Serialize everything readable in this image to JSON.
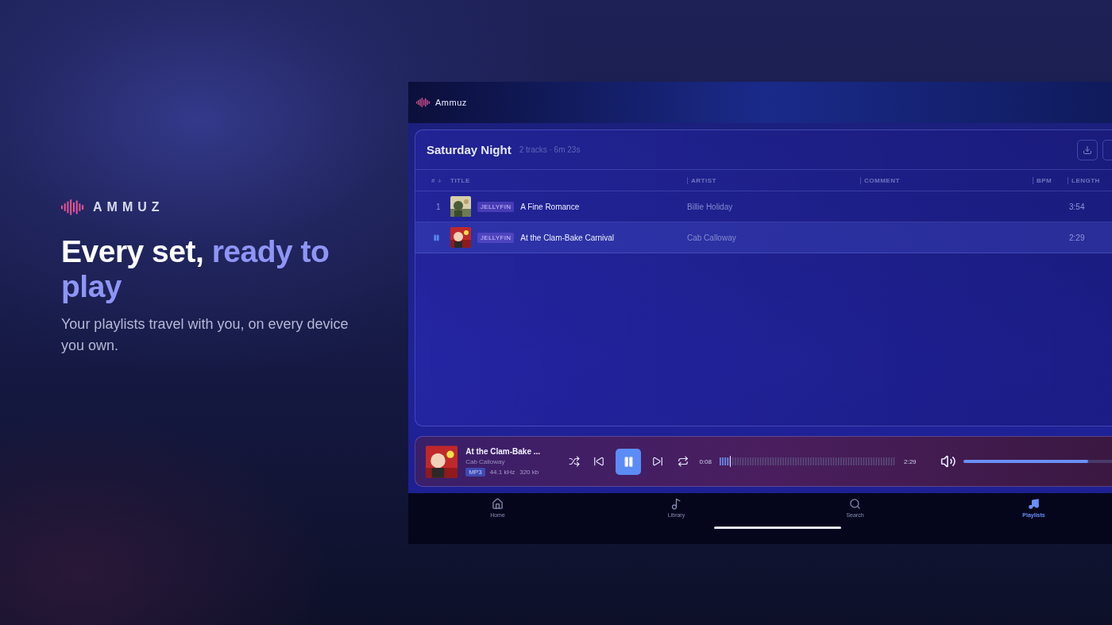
{
  "promo": {
    "brand": "AMMUZ",
    "headline": "Every set,",
    "headline_accent": "ready to play",
    "subtitle": "Your playlists travel with you, on every device you own."
  },
  "app": {
    "name": "Ammuz",
    "playlist": {
      "title": "Saturday Night",
      "meta": "2 tracks · 6m 23s"
    },
    "columns": [
      "#",
      "TITLE",
      "ARTIST",
      "COMMENT",
      "BPM",
      "LENGTH"
    ],
    "rows": [
      {
        "number": "1",
        "playing": false,
        "selected": false,
        "source": "JELLYFIN",
        "title": "A Fine Romance",
        "artist": "Billie Holiday",
        "length": "3:54"
      },
      {
        "playing": true,
        "selected": true,
        "source": "JELLYFIN",
        "title": "At the Clam-Bake Carnival",
        "artist": "Cab Calloway",
        "length": "2:29"
      }
    ],
    "player": {
      "title": "At the Clam-Bake ...",
      "artist": "Cab Calloway",
      "format": "MP3",
      "sample_rate": "44.1 kHz",
      "bitrate": "320 kb",
      "playing": true,
      "elapsed": "0:08",
      "total": "2:29",
      "level": 0.06,
      "volume": {
        "level": 0.78
      }
    },
    "nav": [
      {
        "label": "Home",
        "selected": false
      },
      {
        "label": "Library",
        "selected": false
      },
      {
        "label": "Search",
        "selected": false
      },
      {
        "label": "Playlists",
        "selected": true
      }
    ]
  }
}
